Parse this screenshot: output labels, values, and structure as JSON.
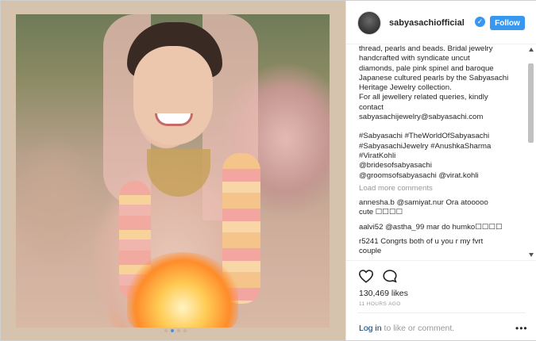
{
  "post": {
    "username": "sabyasachiofficial",
    "verified_icon": "verified-badge-icon",
    "follow_label": "Follow",
    "caption_lines": [
      "thread, pearls and beads. Bridal jewelry",
      "handcrafted with syndicate uncut",
      "diamonds, pale pink spinel and baroque",
      "Japanese cultured pearls by the Sabyasachi",
      "Heritage Jewelry collection.",
      "For all jewellery related queries, kindly",
      "contact",
      "sabyasachijewelry@sabyasachi.com"
    ],
    "hashtag_lines": [
      "#Sabyasachi #TheWorldOfSabyasachi",
      "#SabyasachiJewelry #AnushkaSharma",
      "#ViratKohli",
      "@bridesofsabyasachi",
      "@groomsofsabyasachi @virat.kohli"
    ],
    "load_more": "Load more comments",
    "comments": [
      {
        "text_line1": "annesha.b @samiyat.nur Ora atooooo",
        "text_line2": "cute ☐☐☐☐"
      },
      {
        "text_line1": "aalvi52 @astha_99 mar do humko☐☐☐☐",
        "text_line2": ""
      },
      {
        "text_line1": "r5241 Congrts both of u you r my fvrt",
        "text_line2": "couple"
      }
    ],
    "likes": "130,469 likes",
    "time": "11 HOURS AGO",
    "login_link": "Log in",
    "login_rest": " to like or comment.",
    "more_label": "•••"
  },
  "carousel": {
    "count": 4,
    "active_index": 1
  },
  "colors": {
    "accent": "#3897f0",
    "photo_border": "#d6c3ad"
  }
}
